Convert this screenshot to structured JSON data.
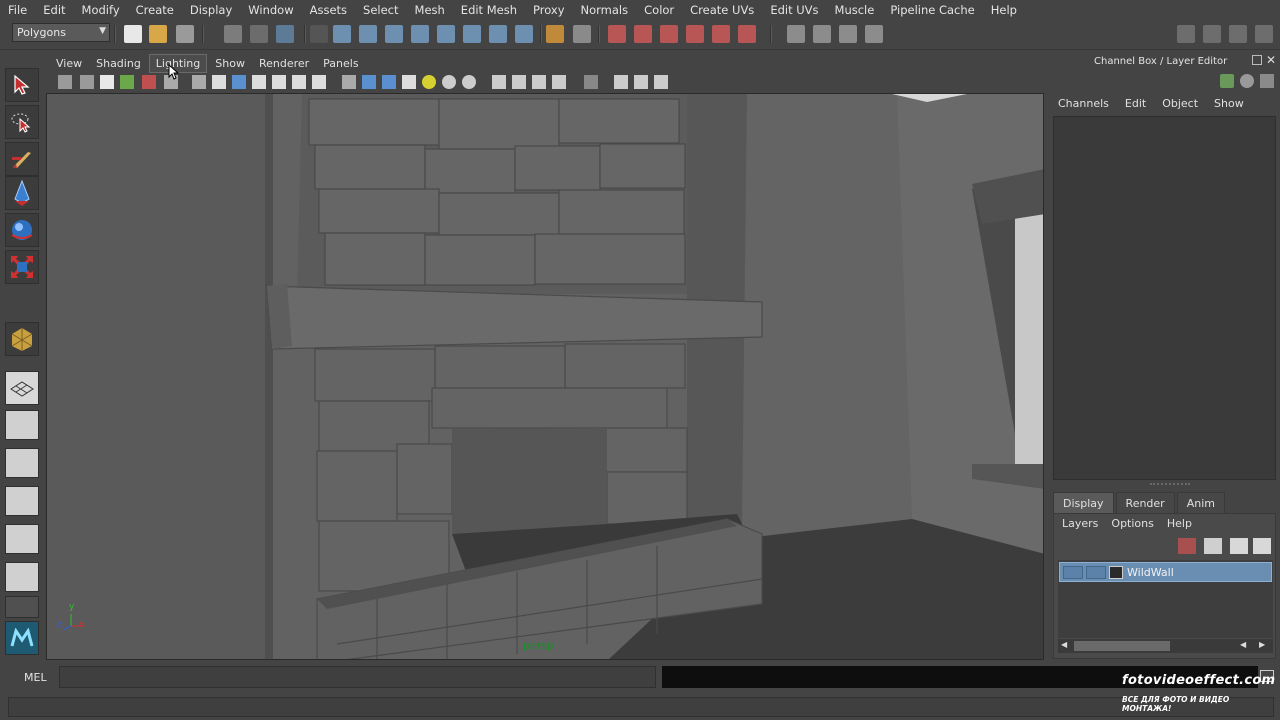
{
  "menubar": {
    "items": [
      "File",
      "Edit",
      "Modify",
      "Create",
      "Display",
      "Window",
      "Assets",
      "Select",
      "Mesh",
      "Edit Mesh",
      "Proxy",
      "Normals",
      "Color",
      "Create UVs",
      "Edit UVs",
      "Muscle",
      "Pipeline Cache",
      "Help"
    ]
  },
  "statusline": {
    "menu_set": "Polygons"
  },
  "panel": {
    "menu": [
      "View",
      "Shading",
      "Lighting",
      "Show",
      "Renderer",
      "Panels"
    ],
    "active_menu": "Lighting",
    "camera_label": "persp",
    "axes": {
      "x": "x",
      "y": "y",
      "z": "z"
    }
  },
  "channel_box": {
    "title": "Channel Box / Layer Editor",
    "menu": [
      "Channels",
      "Edit",
      "Object",
      "Show"
    ]
  },
  "layer_editor": {
    "tabs": [
      "Display",
      "Render",
      "Anim"
    ],
    "active_tab": "Display",
    "menu": [
      "Layers",
      "Options",
      "Help"
    ],
    "layers": [
      {
        "name": "WildWall",
        "selected": true
      }
    ]
  },
  "command_line": {
    "label": "MEL",
    "value": ""
  },
  "watermark": {
    "line1": "fotovideoeffect.com",
    "line2": "ВСЕ ДЛЯ ФОТО И ВИДЕО МОНТАЖА!"
  },
  "colors": {
    "accent_selection": "#6a8db2",
    "camera_label": "#1d8a2c",
    "ui_background": "#444444",
    "viewport_background": "#5e5e5e"
  }
}
